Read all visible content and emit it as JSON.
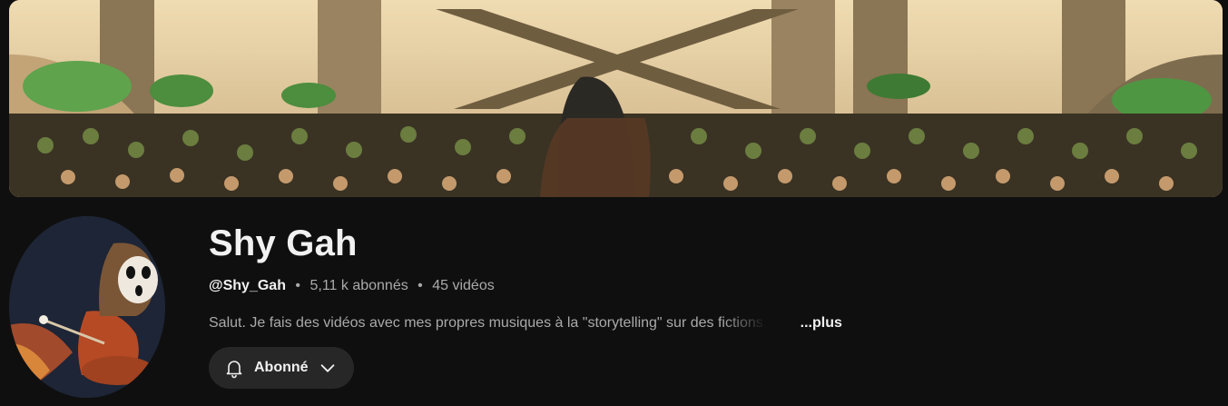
{
  "channel": {
    "name": "Shy Gah",
    "handle": "@Shy_Gah",
    "separator": "•",
    "subscribers": "5,11 k abonnés",
    "videos": "45 vidéos",
    "description": "Salut. Je fais des vidéos avec mes propres musiques à la \"storytelling\" sur des fictions,",
    "more_label": "...plus"
  },
  "subscribe_button": {
    "label": "Abonné",
    "icon": "bell-icon",
    "chevron_icon": "chevron-down-icon"
  },
  "colors": {
    "background": "#0f0f0f",
    "button_bg": "#272727",
    "text_primary": "#f1f1f1",
    "text_secondary": "#aaaaaa"
  }
}
